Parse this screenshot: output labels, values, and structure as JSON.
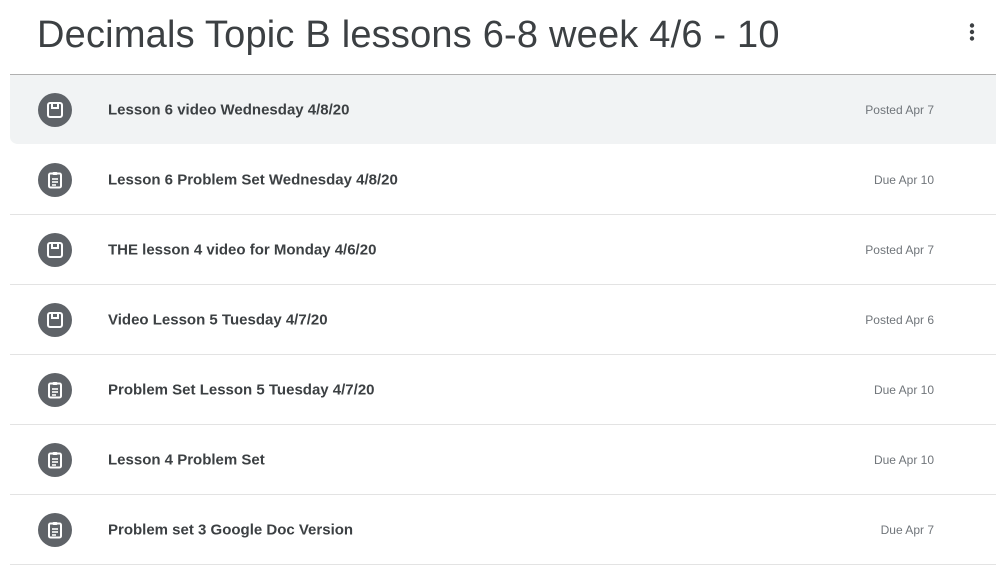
{
  "topic": {
    "title": "Decimals Topic B lessons 6-8 week 4/6 - 10",
    "more_icon": "more-vert-icon"
  },
  "items": [
    {
      "type": "material",
      "icon": "material-icon",
      "title": "Lesson 6 video Wednesday 4/8/20",
      "date": "Posted Apr 7",
      "selected": true
    },
    {
      "type": "assignment",
      "icon": "assignment-icon",
      "title": "Lesson 6 Problem Set Wednesday 4/8/20",
      "date": "Due Apr 10",
      "selected": false
    },
    {
      "type": "material",
      "icon": "material-icon",
      "title": "THE lesson 4 video for Monday 4/6/20",
      "date": "Posted Apr 7",
      "selected": false
    },
    {
      "type": "material",
      "icon": "material-icon",
      "title": "Video Lesson 5 Tuesday 4/7/20",
      "date": "Posted Apr 6",
      "selected": false
    },
    {
      "type": "assignment",
      "icon": "assignment-icon",
      "title": "Problem Set Lesson 5 Tuesday 4/7/20",
      "date": "Due Apr 10",
      "selected": false
    },
    {
      "type": "assignment",
      "icon": "assignment-icon",
      "title": "Lesson 4 Problem Set",
      "date": "Due Apr 10",
      "selected": false
    },
    {
      "type": "assignment",
      "icon": "assignment-icon",
      "title": "Problem set 3 Google Doc Version",
      "date": "Due Apr 7",
      "selected": false
    }
  ],
  "colors": {
    "icon_bg": "#5f6368",
    "selected_bg": "#f1f3f4",
    "text": "#3c4043",
    "date_text": "#70757a"
  }
}
